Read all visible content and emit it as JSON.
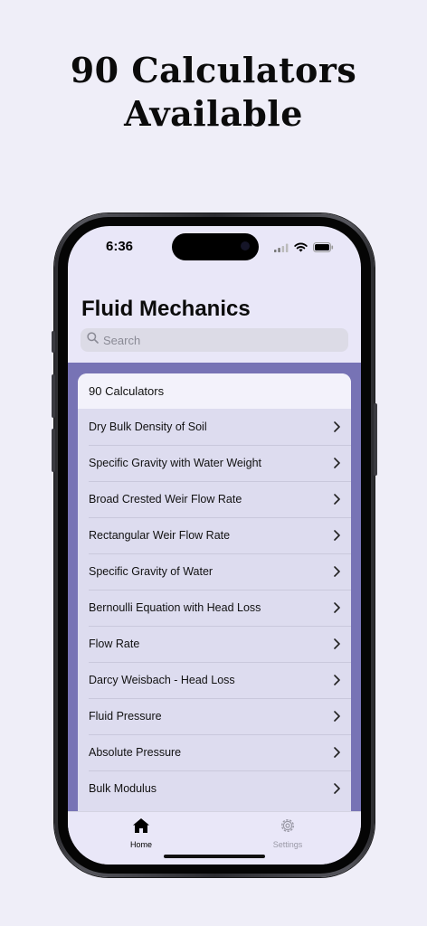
{
  "promo": {
    "title_line1": "90 Calculators",
    "title_line2": "Available"
  },
  "status_bar": {
    "time": "6:36",
    "icons": [
      "cellular-icon",
      "wifi-icon",
      "battery-icon"
    ]
  },
  "nav": {
    "title": "Fluid Mechanics"
  },
  "search": {
    "placeholder": "Search",
    "icon": "search-icon"
  },
  "list": {
    "header": "90 Calculators",
    "items": [
      "Dry Bulk Density of Soil",
      "Specific Gravity with Water Weight",
      "Broad Crested Weir Flow Rate",
      "Rectangular Weir Flow Rate",
      "Specific Gravity of Water",
      "Bernoulli Equation with Head Loss",
      "Flow Rate",
      "Darcy Weisbach - Head Loss",
      "Fluid Pressure",
      "Absolute Pressure",
      "Bulk Modulus"
    ]
  },
  "tab_bar": {
    "tabs": [
      {
        "label": "Home",
        "icon": "home-icon",
        "selected": true
      },
      {
        "label": "Settings",
        "icon": "gear-icon",
        "selected": false
      }
    ]
  },
  "colors": {
    "background": "#efeef8",
    "accent": "#7773b5",
    "list_background": "#dddcef",
    "tab_inactive": "#9a99a6"
  }
}
